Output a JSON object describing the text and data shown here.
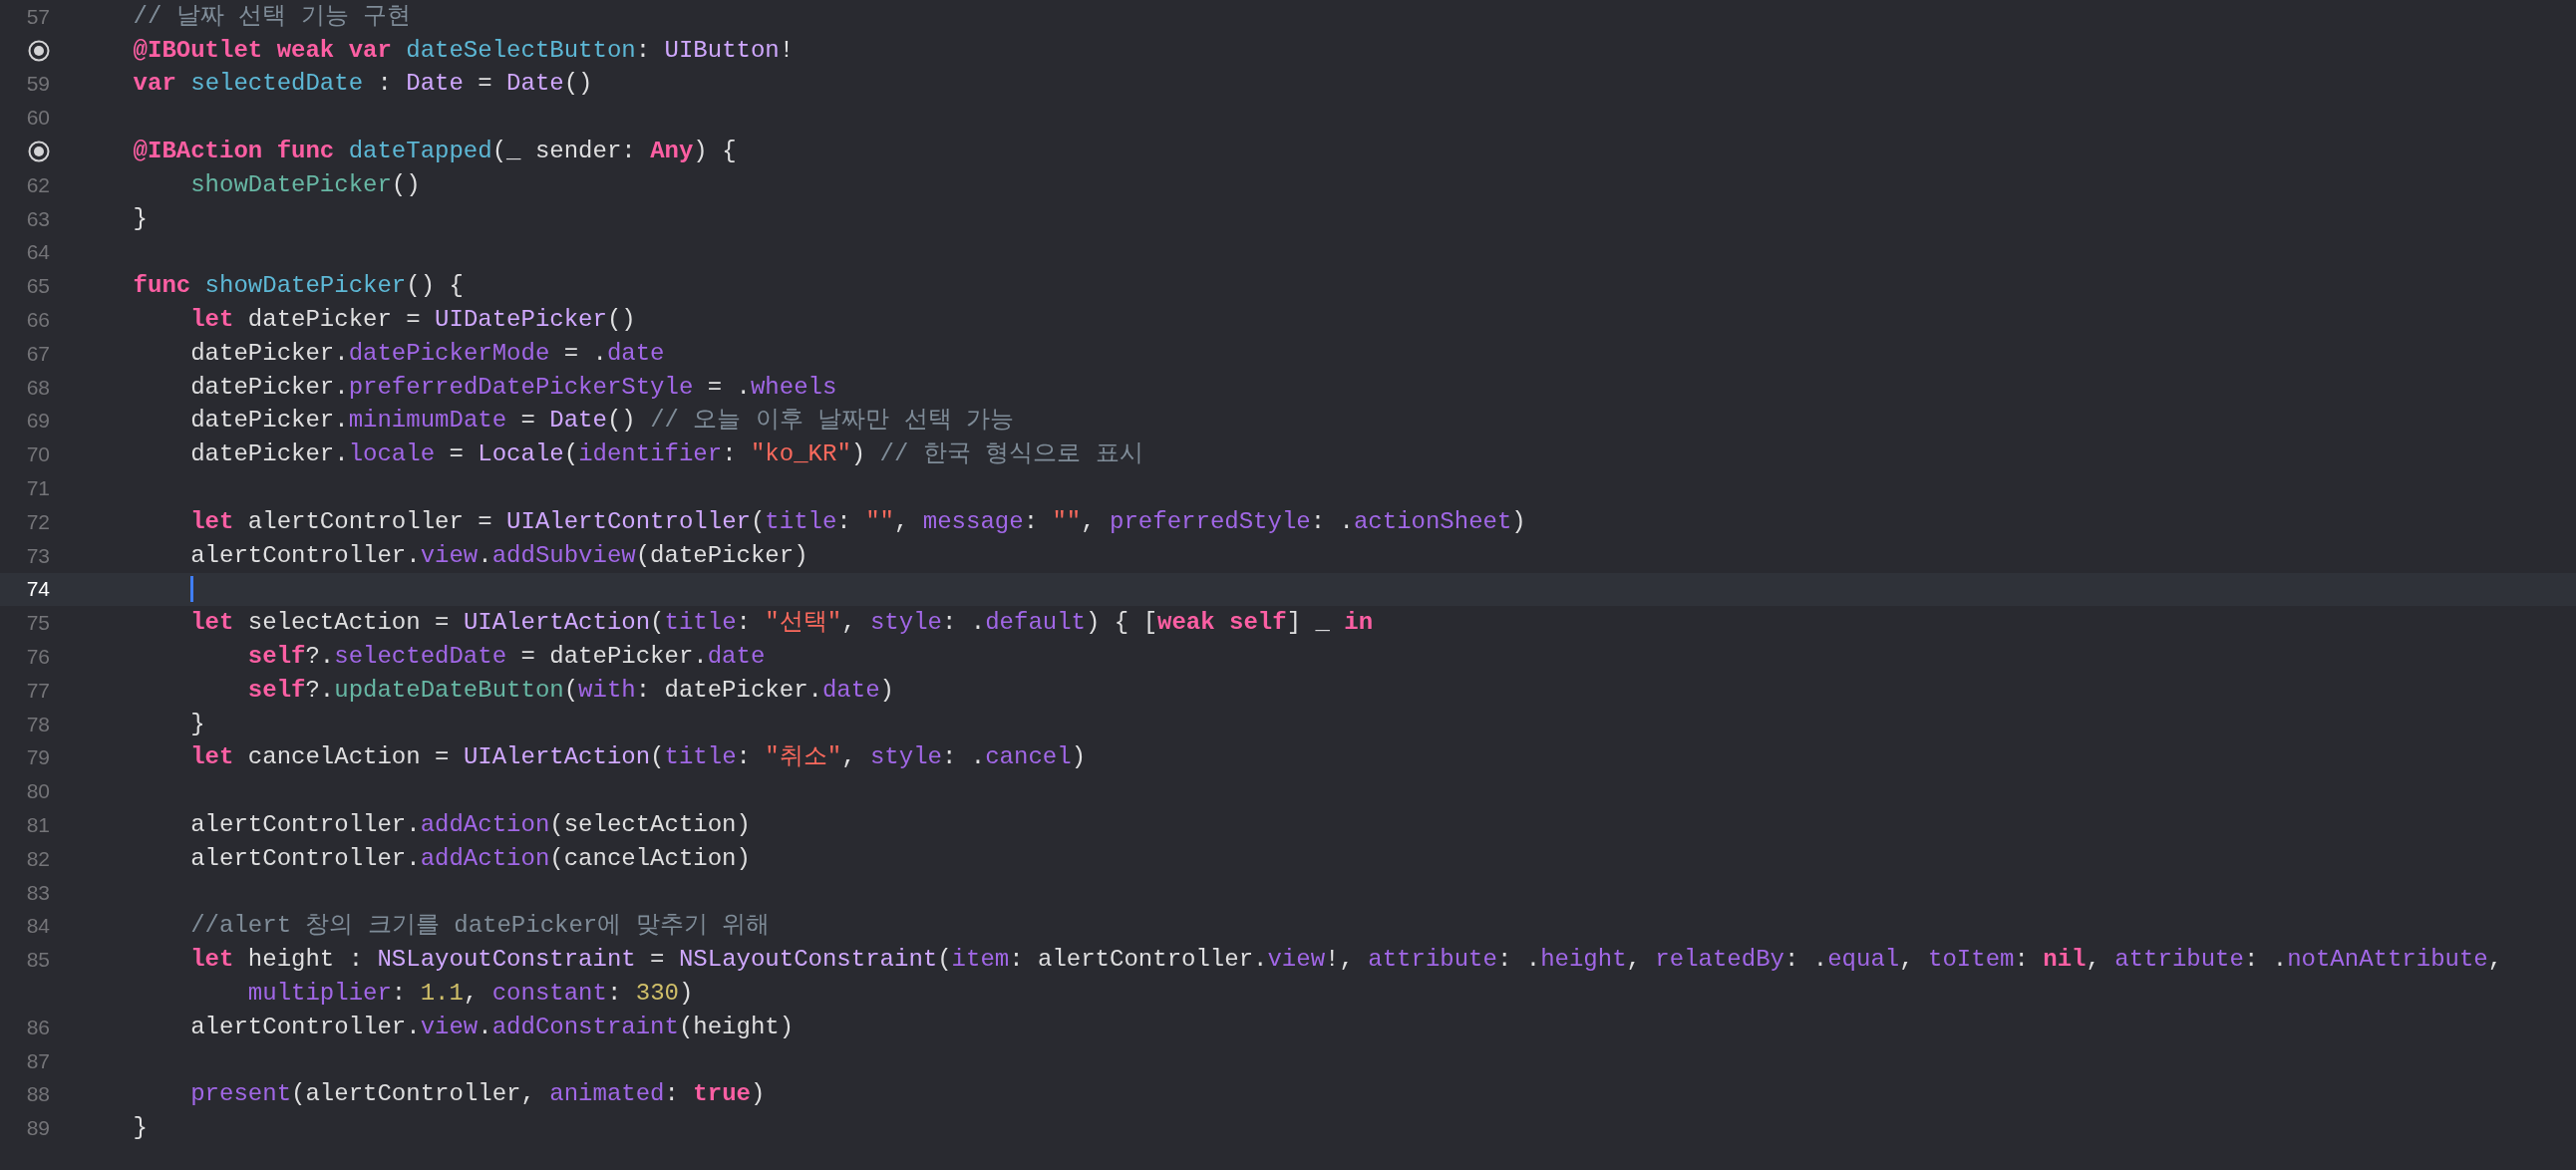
{
  "lines": [
    {
      "number": "57",
      "connected": false,
      "current": false,
      "tokens": [
        {
          "text": "// 날짜 선택 기능 구현",
          "kind": "comment"
        }
      ]
    },
    {
      "connected": true,
      "current": false,
      "tokens": [
        {
          "text": "@IBOutlet weak var",
          "kind": "keyword"
        },
        {
          "text": " dateSelectButton",
          "kind": "declaration"
        },
        {
          "text": ": ",
          "kind": "plain"
        },
        {
          "text": "UIButton",
          "kind": "type"
        },
        {
          "text": "!",
          "kind": "plain"
        }
      ]
    },
    {
      "number": "59",
      "connected": false,
      "current": false,
      "tokens": [
        {
          "text": "var",
          "kind": "keyword"
        },
        {
          "text": " selectedDate",
          "kind": "declaration"
        },
        {
          "text": " : ",
          "kind": "plain"
        },
        {
          "text": "Date",
          "kind": "type"
        },
        {
          "text": " = ",
          "kind": "plain"
        },
        {
          "text": "Date",
          "kind": "type"
        },
        {
          "text": "()",
          "kind": "plain"
        }
      ]
    },
    {
      "number": "60",
      "connected": false,
      "current": false
    },
    {
      "connected": true,
      "current": false,
      "tokens": [
        {
          "text": "@IBAction func",
          "kind": "keyword"
        },
        {
          "text": " dateTapped",
          "kind": "declaration"
        },
        {
          "text": "(_ sender: ",
          "kind": "plain"
        },
        {
          "text": "Any",
          "kind": "keyword"
        },
        {
          "text": ") {",
          "kind": "plain"
        }
      ],
      "children": [
        {
          "number": "62",
          "connected": false,
          "current": false,
          "tokens": [
            {
              "text": "showDatePicker",
              "kind": "call"
            },
            {
              "text": "()",
              "kind": "plain"
            }
          ]
        }
      ]
    },
    {
      "number": "63",
      "connected": false,
      "current": false,
      "tokens": [
        {
          "text": "}",
          "kind": "plain"
        }
      ]
    },
    {
      "number": "64",
      "connected": false,
      "current": false
    },
    {
      "number": "65",
      "connected": false,
      "current": false,
      "tokens": [
        {
          "text": "func",
          "kind": "keyword"
        },
        {
          "text": " showDatePicker",
          "kind": "declaration"
        },
        {
          "text": "() {",
          "kind": "plain"
        }
      ],
      "children": [
        {
          "number": "66",
          "connected": false,
          "current": false,
          "tokens": [
            {
              "text": "let",
              "kind": "keyword"
            },
            {
              "text": " datePicker = ",
              "kind": "plain"
            },
            {
              "text": "UIDatePicker",
              "kind": "type"
            },
            {
              "text": "()",
              "kind": "plain"
            }
          ]
        },
        {
          "number": "67",
          "connected": false,
          "current": false,
          "tokens": [
            {
              "text": "datePicker.",
              "kind": "plain"
            },
            {
              "text": "datePickerMode",
              "kind": "member"
            },
            {
              "text": " = .",
              "kind": "plain"
            },
            {
              "text": "date",
              "kind": "member"
            }
          ]
        },
        {
          "number": "68",
          "connected": false,
          "current": false,
          "tokens": [
            {
              "text": "datePicker.",
              "kind": "plain"
            },
            {
              "text": "preferredDatePickerStyle",
              "kind": "member"
            },
            {
              "text": " = .",
              "kind": "plain"
            },
            {
              "text": "wheels",
              "kind": "member"
            }
          ]
        },
        {
          "number": "69",
          "connected": false,
          "current": false,
          "tokens": [
            {
              "text": "datePicker.",
              "kind": "plain"
            },
            {
              "text": "minimumDate",
              "kind": "member"
            },
            {
              "text": " = ",
              "kind": "plain"
            },
            {
              "text": "Date",
              "kind": "type"
            },
            {
              "text": "() ",
              "kind": "plain"
            },
            {
              "text": "// 오늘 이후 날짜만 선택 가능",
              "kind": "comment"
            }
          ]
        },
        {
          "number": "70",
          "connected": false,
          "current": false,
          "tokens": [
            {
              "text": "datePicker.",
              "kind": "plain"
            },
            {
              "text": "locale",
              "kind": "member"
            },
            {
              "text": " = ",
              "kind": "plain"
            },
            {
              "text": "Locale",
              "kind": "type"
            },
            {
              "text": "(",
              "kind": "plain"
            },
            {
              "text": "identifier",
              "kind": "member"
            },
            {
              "text": ": ",
              "kind": "plain"
            },
            {
              "text": "\"ko_KR\"",
              "kind": "string"
            },
            {
              "text": ") ",
              "kind": "plain"
            },
            {
              "text": "// 한국 형식으로 표시",
              "kind": "comment"
            }
          ]
        },
        {
          "number": "71",
          "connected": false,
          "current": false
        },
        {
          "number": "72",
          "connected": false,
          "current": false,
          "tokens": [
            {
              "text": "let",
              "kind": "keyword"
            },
            {
              "text": " alertController = ",
              "kind": "plain"
            },
            {
              "text": "UIAlertController",
              "kind": "type"
            },
            {
              "text": "(",
              "kind": "plain"
            },
            {
              "text": "title",
              "kind": "member"
            },
            {
              "text": ": ",
              "kind": "plain"
            },
            {
              "text": "\"\"",
              "kind": "string"
            },
            {
              "text": ", ",
              "kind": "plain"
            },
            {
              "text": "message",
              "kind": "member"
            },
            {
              "text": ": ",
              "kind": "plain"
            },
            {
              "text": "\"\"",
              "kind": "string"
            },
            {
              "text": ", ",
              "kind": "plain"
            },
            {
              "text": "preferredStyle",
              "kind": "member"
            },
            {
              "text": ": .",
              "kind": "plain"
            },
            {
              "text": "actionSheet",
              "kind": "member"
            },
            {
              "text": ")",
              "kind": "plain"
            }
          ]
        },
        {
          "number": "73",
          "connected": false,
          "current": false,
          "tokens": [
            {
              "text": "alertController.",
              "kind": "plain"
            },
            {
              "text": "view",
              "kind": "member"
            },
            {
              "text": ".",
              "kind": "plain"
            },
            {
              "text": "addSubview",
              "kind": "member"
            },
            {
              "text": "(datePicker)",
              "kind": "plain"
            }
          ]
        },
        {
          "number": "74",
          "connected": false,
          "current": true
        },
        {
          "number": "75",
          "connected": false,
          "current": false,
          "tokens": [
            {
              "text": "let",
              "kind": "keyword"
            },
            {
              "text": " selectAction = ",
              "kind": "plain"
            },
            {
              "text": "UIAlertAction",
              "kind": "type"
            },
            {
              "text": "(",
              "kind": "plain"
            },
            {
              "text": "title",
              "kind": "member"
            },
            {
              "text": ": ",
              "kind": "plain"
            },
            {
              "text": "\"선택\"",
              "kind": "string"
            },
            {
              "text": ", ",
              "kind": "plain"
            },
            {
              "text": "style",
              "kind": "member"
            },
            {
              "text": ": .",
              "kind": "plain"
            },
            {
              "text": "default",
              "kind": "member"
            },
            {
              "text": ") { [",
              "kind": "plain"
            },
            {
              "text": "weak self",
              "kind": "keyword"
            },
            {
              "text": "] _ ",
              "kind": "plain"
            },
            {
              "text": "in",
              "kind": "keyword"
            }
          ],
          "children": [
            {
              "number": "76",
              "connected": false,
              "current": false,
              "tokens": [
                {
                  "text": "self",
                  "kind": "keyword"
                },
                {
                  "text": "?.",
                  "kind": "plain"
                },
                {
                  "text": "selectedDate",
                  "kind": "member"
                },
                {
                  "text": " = datePicker.",
                  "kind": "plain"
                },
                {
                  "text": "date",
                  "kind": "member"
                }
              ]
            },
            {
              "number": "77",
              "connected": false,
              "current": false,
              "tokens": [
                {
                  "text": "self",
                  "kind": "keyword"
                },
                {
                  "text": "?.",
                  "kind": "plain"
                },
                {
                  "text": "updateDateButton",
                  "kind": "call"
                },
                {
                  "text": "(",
                  "kind": "plain"
                },
                {
                  "text": "with",
                  "kind": "member"
                },
                {
                  "text": ": datePicker.",
                  "kind": "plain"
                },
                {
                  "text": "date",
                  "kind": "member"
                },
                {
                  "text": ")",
                  "kind": "plain"
                }
              ]
            }
          ]
        },
        {
          "number": "78",
          "connected": false,
          "current": false,
          "tokens": [
            {
              "text": "}",
              "kind": "plain"
            }
          ]
        },
        {
          "number": "79",
          "connected": false,
          "current": false,
          "tokens": [
            {
              "text": "let",
              "kind": "keyword"
            },
            {
              "text": " cancelAction = ",
              "kind": "plain"
            },
            {
              "text": "UIAlertAction",
              "kind": "type"
            },
            {
              "text": "(",
              "kind": "plain"
            },
            {
              "text": "title",
              "kind": "member"
            },
            {
              "text": ": ",
              "kind": "plain"
            },
            {
              "text": "\"취소\"",
              "kind": "string"
            },
            {
              "text": ", ",
              "kind": "plain"
            },
            {
              "text": "style",
              "kind": "member"
            },
            {
              "text": ": .",
              "kind": "plain"
            },
            {
              "text": "cancel",
              "kind": "member"
            },
            {
              "text": ")",
              "kind": "plain"
            }
          ]
        },
        {
          "number": "80",
          "connected": false,
          "current": false
        },
        {
          "number": "81",
          "connected": false,
          "current": false,
          "tokens": [
            {
              "text": "alertController.",
              "kind": "plain"
            },
            {
              "text": "addAction",
              "kind": "member"
            },
            {
              "text": "(selectAction)",
              "kind": "plain"
            }
          ]
        },
        {
          "number": "82",
          "connected": false,
          "current": false,
          "tokens": [
            {
              "text": "alertController.",
              "kind": "plain"
            },
            {
              "text": "addAction",
              "kind": "member"
            },
            {
              "text": "(cancelAction)",
              "kind": "plain"
            }
          ]
        },
        {
          "number": "83",
          "connected": false,
          "current": false
        },
        {
          "number": "84",
          "connected": false,
          "current": false,
          "tokens": [
            {
              "text": "//alert 창의 크기를 datePicker에 맞추기 위해",
              "kind": "comment"
            }
          ]
        },
        {
          "number": "85",
          "connected": false,
          "current": false,
          "tokens": [
            {
              "text": "let",
              "kind": "keyword"
            },
            {
              "text": " height : ",
              "kind": "plain"
            },
            {
              "text": "NSLayoutConstraint",
              "kind": "type"
            },
            {
              "text": " = ",
              "kind": "plain"
            },
            {
              "text": "NSLayoutConstraint",
              "kind": "type"
            },
            {
              "text": "(",
              "kind": "plain"
            },
            {
              "text": "item",
              "kind": "member"
            },
            {
              "text": ": alertController.",
              "kind": "plain"
            },
            {
              "text": "view",
              "kind": "member"
            },
            {
              "text": "!, ",
              "kind": "plain"
            },
            {
              "text": "attribute",
              "kind": "member"
            },
            {
              "text": ": .",
              "kind": "plain"
            },
            {
              "text": "height",
              "kind": "member"
            },
            {
              "text": ", ",
              "kind": "plain"
            },
            {
              "text": "relatedBy",
              "kind": "member"
            },
            {
              "text": ": .",
              "kind": "plain"
            },
            {
              "text": "equal",
              "kind": "member"
            },
            {
              "text": ", ",
              "kind": "plain"
            },
            {
              "text": "toItem",
              "kind": "member"
            },
            {
              "text": ": ",
              "kind": "plain"
            },
            {
              "text": "nil",
              "kind": "keyword"
            },
            {
              "text": ", ",
              "kind": "plain"
            },
            {
              "text": "attribute",
              "kind": "member"
            },
            {
              "text": ": .",
              "kind": "plain"
            },
            {
              "text": "notAnAttribute",
              "kind": "member"
            },
            {
              "text": ",",
              "kind": "plain"
            }
          ],
          "wrap": [
            {
              "text": "multiplier",
              "kind": "member"
            },
            {
              "text": ": ",
              "kind": "plain"
            },
            {
              "text": "1.1",
              "kind": "number"
            },
            {
              "text": ", ",
              "kind": "plain"
            },
            {
              "text": "constant",
              "kind": "member"
            },
            {
              "text": ": ",
              "kind": "plain"
            },
            {
              "text": "330",
              "kind": "number"
            },
            {
              "text": ")",
              "kind": "plain"
            }
          ]
        },
        {
          "number": "86",
          "connected": false,
          "current": false,
          "tokens": [
            {
              "text": "alertController.",
              "kind": "plain"
            },
            {
              "text": "view",
              "kind": "member"
            },
            {
              "text": ".",
              "kind": "plain"
            },
            {
              "text": "addConstraint",
              "kind": "member"
            },
            {
              "text": "(height)",
              "kind": "plain"
            }
          ]
        },
        {
          "number": "87",
          "connected": false,
          "current": false
        },
        {
          "number": "88",
          "connected": false,
          "current": false,
          "tokens": [
            {
              "text": "present",
              "kind": "member"
            },
            {
              "text": "(alertController, ",
              "kind": "plain"
            },
            {
              "text": "animated",
              "kind": "member"
            },
            {
              "text": ": ",
              "kind": "plain"
            },
            {
              "text": "true",
              "kind": "keyword"
            },
            {
              "text": ")",
              "kind": "plain"
            }
          ]
        }
      ]
    },
    {
      "number": "89",
      "connected": false,
      "current": false,
      "tokens": [
        {
          "text": "}",
          "kind": "plain"
        }
      ]
    }
  ]
}
